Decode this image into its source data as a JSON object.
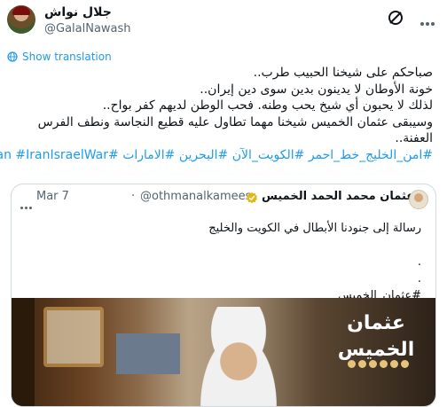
{
  "header": {
    "display_name": "جلال نواش",
    "handle": "@GalalNawash"
  },
  "translate_label": "Show translation",
  "tweet_lines": [
    "صباحكم على شيخنا الحبيب طرب..",
    "خونة الأوطان لا يدينون بدين سوى دين إيران..",
    "لذلك لا يحبون أي شيخ يحب وطنه. فحب الوطن لديهم كفر بواح..",
    "وسيبقى عثمان الخميس شيخنا مهما تطاول عليه قطيع النجاسة ونطف الفرس",
    "العفنة.."
  ],
  "hashtags": "#امن_الخليج_خط_احمر #الكويت_الآن #البحرين #الامارات #Iran #IranIsraelWar",
  "quote": {
    "name": "د. عثمان محمد الحمد الخميس",
    "handle": "@othmanalkamees",
    "separator": "·",
    "date": "Mar 7",
    "lines": [
      "رسالة إلى جنودنا الأبطال في الكويت والخليج",
      "",
      ".",
      ".",
      "#عثمان_الخميس"
    ],
    "media_logo": "عثمان الخميس"
  },
  "colors": {
    "accent": "#1d9bf0",
    "muted": "#536471",
    "verified": "#e2b719"
  }
}
